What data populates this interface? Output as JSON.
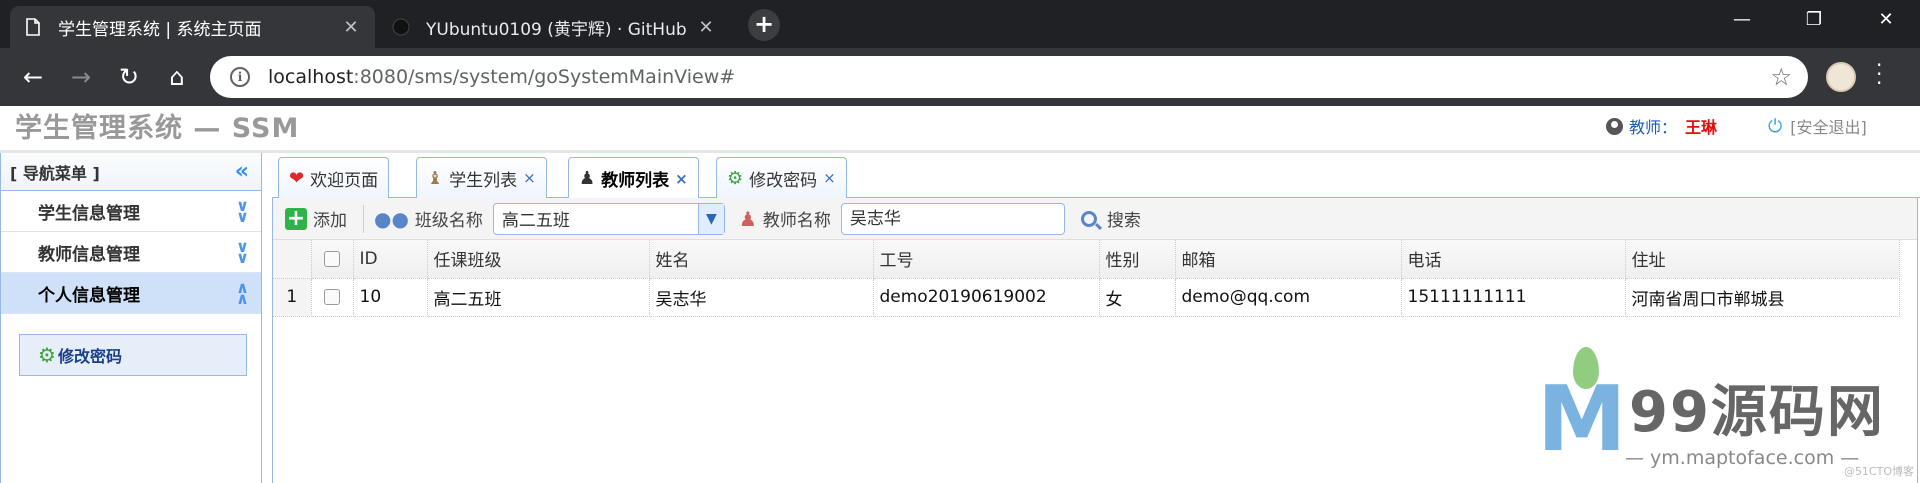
{
  "browser": {
    "tabs": [
      {
        "title": "学生管理系统 | 系统主页面",
        "close": "✕"
      },
      {
        "title": "YUbuntu0109 (黄宇辉) · GitHub",
        "close": "✕"
      }
    ],
    "new_tab": "+",
    "url_host": "localhost",
    "url_path": ":8080/sms/system/goSystemMainView#"
  },
  "header": {
    "app_title": "学生管理系统 — SSM",
    "role_label": "教师：",
    "user_name": "王琳",
    "logout": "[安全退出]"
  },
  "sidebar": {
    "title": "[ 导航菜单 ]",
    "items": [
      {
        "label": "学生信息管理"
      },
      {
        "label": "教师信息管理"
      },
      {
        "label": "个人信息管理"
      }
    ],
    "sub_button": "修改密码"
  },
  "content_tabs": [
    {
      "label": "欢迎页面",
      "icon": "heart-icon"
    },
    {
      "label": "学生列表",
      "icon": "student-icon",
      "close": "×"
    },
    {
      "label": "教师列表",
      "icon": "teacher-icon",
      "close": "×"
    },
    {
      "label": "修改密码",
      "icon": "gear-icon",
      "close": "×"
    }
  ],
  "toolbar": {
    "add_label": "添加",
    "class_label": "班级名称",
    "class_value": "高二五班",
    "teacher_label": "教师名称",
    "teacher_value": "吴志华",
    "search_label": "搜索"
  },
  "table": {
    "columns": [
      "ID",
      "任课班级",
      "姓名",
      "工号",
      "性别",
      "邮箱",
      "电话",
      "住址"
    ],
    "rows": [
      {
        "num": "1",
        "id": "10",
        "class": "高二五班",
        "name": "吴志华",
        "no": "demo20190619002",
        "gender": "女",
        "email": "demo@qq.com",
        "phone": "15111111111",
        "address": "河南省周口市郸城县"
      }
    ]
  },
  "watermark": {
    "big": "99源码网",
    "sub": "— ym.maptoface.com —",
    "corner": "@51CTO博客"
  },
  "colors": {
    "accent_border": "#95b8e7",
    "selected_bg": "#cfe1f8",
    "user_name": "#e01010",
    "role": "#1a5cbc"
  }
}
